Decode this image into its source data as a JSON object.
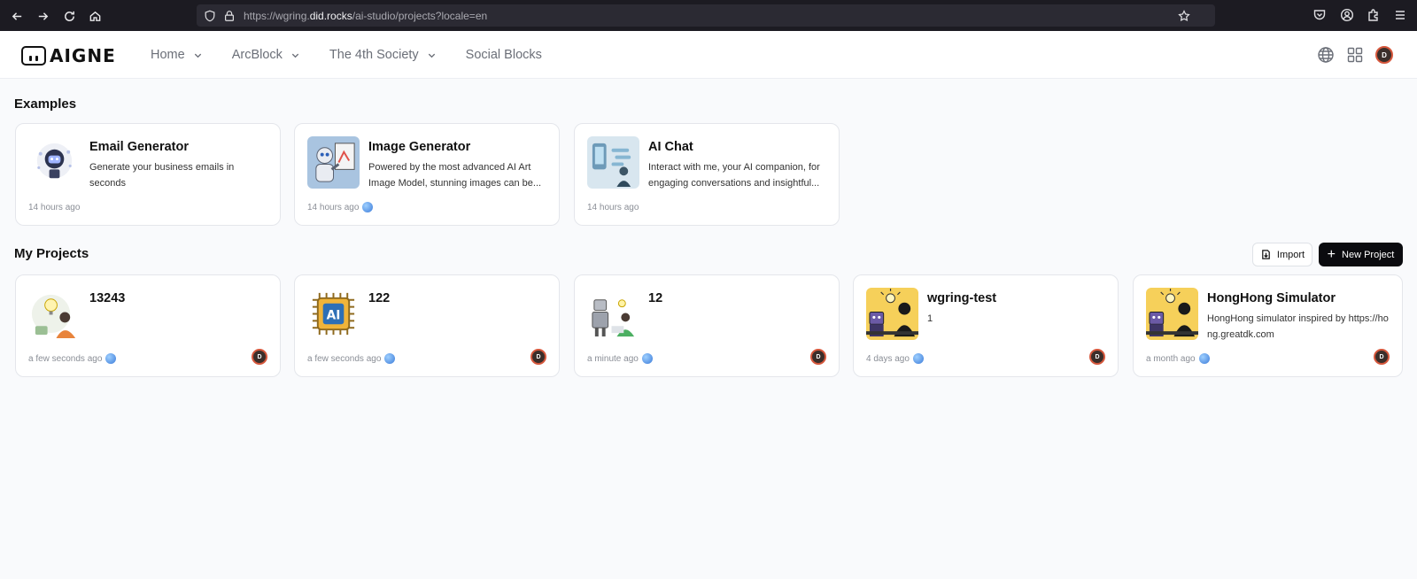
{
  "browser": {
    "url_prefix": "https://wgring.",
    "url_domain": "did.rocks",
    "url_path": "/ai-studio/projects?locale=en"
  },
  "header": {
    "logo_text": "AIGNE",
    "nav": [
      {
        "label": "Home",
        "has_dropdown": true
      },
      {
        "label": "ArcBlock",
        "has_dropdown": true
      },
      {
        "label": "The 4th Society",
        "has_dropdown": true
      },
      {
        "label": "Social Blocks",
        "has_dropdown": false
      }
    ],
    "icons": [
      "globe-icon",
      "apps-grid-icon",
      "user-avatar"
    ]
  },
  "examples": {
    "title": "Examples",
    "cards": [
      {
        "title": "Email Generator",
        "desc": "Generate your business emails in seconds",
        "time": "14 hours ago",
        "has_badge": false,
        "thumb": "email-robot"
      },
      {
        "title": "Image Generator",
        "desc": "Powered by the most advanced AI Art Image Model, stunning images can be...",
        "time": "14 hours ago",
        "has_badge": true,
        "thumb": "painting-robot"
      },
      {
        "title": "AI Chat",
        "desc": "Interact with me, your AI companion, for engaging conversations and insightful...",
        "time": "14 hours ago",
        "has_badge": false,
        "thumb": "chat-person"
      }
    ]
  },
  "projects": {
    "title": "My Projects",
    "import_label": "Import",
    "new_label": "New Project",
    "cards": [
      {
        "title": "13243",
        "desc": "",
        "time": "a few seconds ago",
        "thumb": "idea-person"
      },
      {
        "title": "122",
        "desc": "",
        "time": "a few seconds ago",
        "thumb": "ai-chip"
      },
      {
        "title": "12",
        "desc": "",
        "time": "a minute ago",
        "thumb": "robot-desk"
      },
      {
        "title": "wgring-test",
        "desc": "1",
        "time": "4 days ago",
        "thumb": "robot-bulb"
      },
      {
        "title": "HongHong Simulator",
        "desc": "HongHong simulator inspired by https://hong.greatdk.com",
        "time": "a month ago",
        "thumb": "robot-bulb"
      }
    ]
  },
  "colors": {
    "accent": "#0b0b0f",
    "muted_text": "#6b6f78",
    "page_bg": "#f9fafc",
    "avatar_ring": "#d6573c"
  }
}
